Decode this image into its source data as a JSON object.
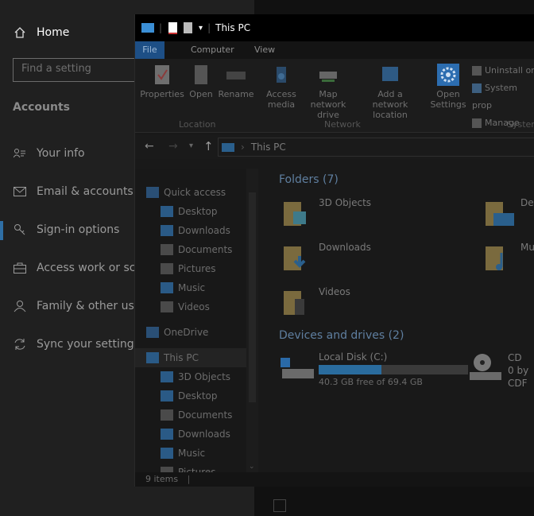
{
  "settings": {
    "home_label": "Home",
    "search_placeholder": "Find a setting",
    "section_title": "Accounts",
    "items": [
      {
        "label": "Your info",
        "icon": "person-card-icon"
      },
      {
        "label": "Email & accounts",
        "icon": "mail-icon"
      },
      {
        "label": "Sign-in options",
        "icon": "key-icon"
      },
      {
        "label": "Access work or scho",
        "icon": "briefcase-icon"
      },
      {
        "label": "Family & other user",
        "icon": "person-icon"
      },
      {
        "label": "Sync your settings",
        "icon": "sync-icon"
      }
    ]
  },
  "explorer": {
    "title": "This PC",
    "tabs": [
      "File",
      "Computer",
      "View"
    ],
    "ribbon": {
      "location": [
        "Properties",
        "Open",
        "Rename"
      ],
      "network": [
        "Access media",
        "Map network drive",
        "Add a network location"
      ],
      "system": [
        "Open Settings"
      ],
      "system_side": [
        "Uninstall or",
        "System prop",
        "Manage"
      ],
      "groups": [
        "Location",
        "Network",
        "System"
      ]
    },
    "address": "This PC",
    "nav": [
      {
        "label": "Quick access",
        "level": 0
      },
      {
        "label": "Desktop",
        "level": 1
      },
      {
        "label": "Downloads",
        "level": 1
      },
      {
        "label": "Documents",
        "level": 1
      },
      {
        "label": "Pictures",
        "level": 1
      },
      {
        "label": "Music",
        "level": 1
      },
      {
        "label": "Videos",
        "level": 1
      },
      {
        "label": "OneDrive",
        "level": 0
      },
      {
        "label": "This PC",
        "level": 0
      },
      {
        "label": "3D Objects",
        "level": 1
      },
      {
        "label": "Desktop",
        "level": 1
      },
      {
        "label": "Documents",
        "level": 1
      },
      {
        "label": "Downloads",
        "level": 1
      },
      {
        "label": "Music",
        "level": 1
      },
      {
        "label": "Pictures",
        "level": 1
      }
    ],
    "folders_header": "Folders (7)",
    "folders": [
      "3D Objects",
      "Downloads",
      "Videos",
      "Des",
      "Mu"
    ],
    "drives_header": "Devices and drives (2)",
    "drive": {
      "name": "Local Disk (C:)",
      "free": "40.3 GB free of 69.4 GB",
      "used_fraction": 0.42
    },
    "cd": [
      "CD",
      "0 by",
      "CDF"
    ],
    "status": "9 items"
  }
}
